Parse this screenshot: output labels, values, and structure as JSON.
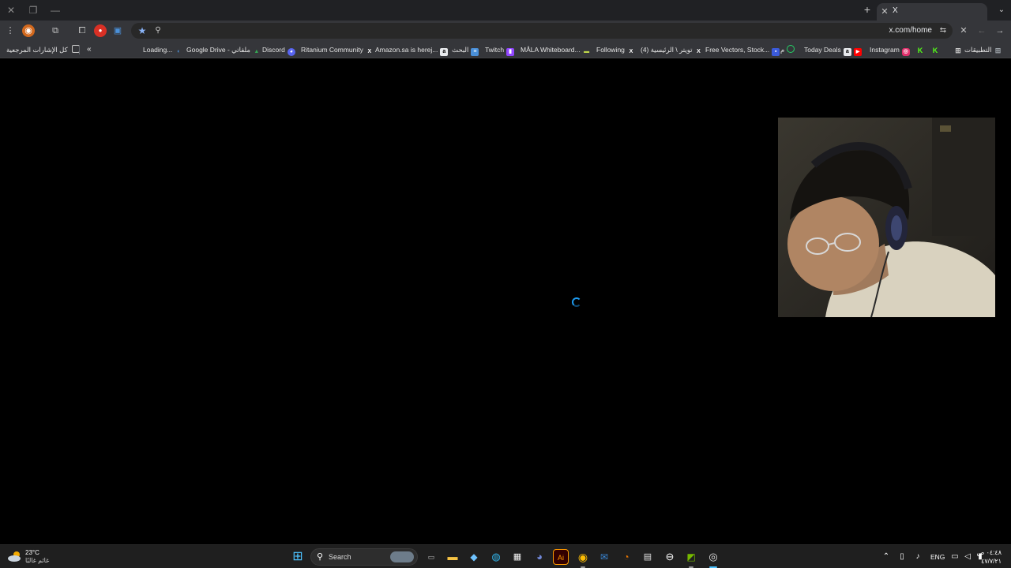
{
  "browser": {
    "tab_title": "X",
    "tab_favicon": "x-logo-icon",
    "url": "x.com/home",
    "window_controls": [
      "close-icon",
      "maximize-icon",
      "minimize-icon"
    ]
  },
  "bookmarks": {
    "all_bookmarks_label": "كل الإشارات المرجعية",
    "overflow_label": "«",
    "items": [
      {
        "label": "Loading...",
        "icon": "loading-icon",
        "color": "#4a90d9"
      },
      {
        "label": "Google Drive - ملفاتي",
        "icon": "google-drive-icon",
        "color": "#34a853"
      },
      {
        "label": "Discord",
        "icon": "discord-icon",
        "color": "#5865f2"
      },
      {
        "label": "Ritanium Community",
        "icon": "x-logo-icon",
        "color": "#000000"
      },
      {
        "label": "Amazon.sa is herej...",
        "icon": "amazon-icon",
        "color": "#232f3e"
      },
      {
        "label": "البحث",
        "icon": "search-bookmark-icon",
        "color": "#4a90d9"
      },
      {
        "label": "Twitch",
        "icon": "twitch-icon",
        "color": "#9146ff"
      },
      {
        "label": "MÅLA Whiteboard...",
        "icon": "whiteboard-icon",
        "color": "#c0d84a"
      },
      {
        "label": "Following",
        "icon": "x-logo-icon",
        "color": "#000000"
      },
      {
        "label": "(4) تويتر \\ الرئيسية",
        "icon": "x-logo-icon",
        "color": "#000000"
      },
      {
        "label": "Free Vectors, Stock...",
        "icon": "freepik-icon",
        "color": "#3b5bdb"
      },
      {
        "label": "م",
        "icon": "whatsapp-icon",
        "color": "#25d366"
      },
      {
        "label": "Today Deals",
        "icon": "amazon-icon",
        "color": "#232f3e"
      },
      {
        "label": "",
        "icon": "youtube-icon",
        "color": "#ff0000"
      },
      {
        "label": "Instagram",
        "icon": "instagram-icon",
        "color": "#e1306c"
      },
      {
        "label": "",
        "icon": "kick-icon",
        "color": "#53fc18"
      },
      {
        "label": "",
        "icon": "kick-icon",
        "color": "#53fc18"
      },
      {
        "label": "التطبيقات",
        "icon": "apps-grid-icon",
        "color": "#9aa0a6"
      }
    ]
  },
  "page": {
    "loading_spinner": "loading-spinner",
    "accent": "#1d9bf0"
  },
  "taskbar": {
    "weather": {
      "temp": "23°C",
      "condition": "غائم غالبًا"
    },
    "search_label": "Search",
    "language": "ENG",
    "clock": {
      "time": "٠٤:٤٨ ص",
      "date": "٤٧/٧/٢١"
    },
    "apps": [
      "windows-start-icon",
      "task-view-icon",
      "file-explorer-icon",
      "copilot-icon",
      "edge-icon",
      "store-icon",
      "discord-icon",
      "illustrator-icon",
      "chrome-icon",
      "mail-icon",
      "blender-icon",
      "calculator-icon",
      "media-icon",
      "nvidia-icon",
      "obs-icon"
    ]
  }
}
